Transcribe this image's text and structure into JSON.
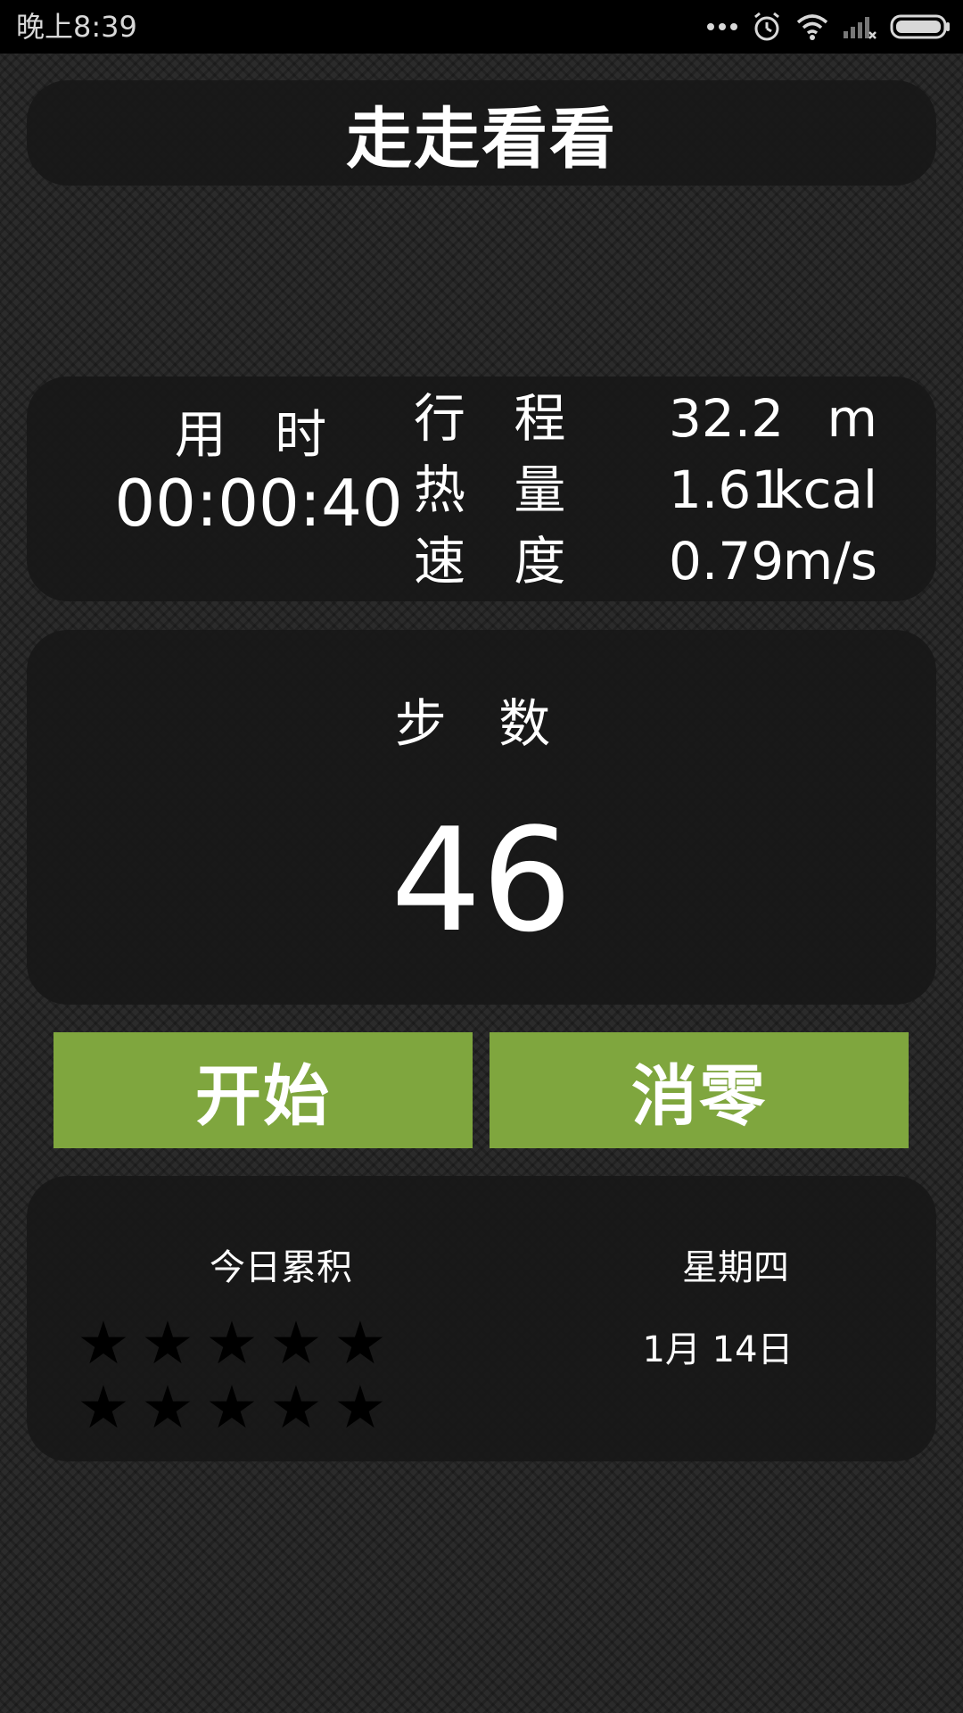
{
  "status_bar": {
    "time": "晚上8:39",
    "icons": [
      "more-dots-icon",
      "alarm-icon",
      "wifi-icon",
      "signal-icon",
      "battery-icon"
    ]
  },
  "header": {
    "title": "走走看看"
  },
  "stats": {
    "time_label": "用 时",
    "time_value": "00:00:40",
    "distance_label": "行 程",
    "distance_value": "32.2",
    "distance_unit": "m",
    "calories_label": "热 量",
    "calories_value": "1.61",
    "calories_unit": "kcal",
    "speed_label": "速 度",
    "speed_value": "0.79",
    "speed_unit": "m/s"
  },
  "steps": {
    "label": "步 数",
    "value": "46"
  },
  "buttons": {
    "start": "开始",
    "reset": "消零"
  },
  "summary": {
    "today_label": "今日累积",
    "weekday": "星期四",
    "date": "1月 14日",
    "stars_total": 10,
    "stars_filled": 0
  },
  "colors": {
    "accent": "#7fa63e",
    "panel": "#181818",
    "background": "#2b2b2b",
    "status_bar": "#000000"
  }
}
